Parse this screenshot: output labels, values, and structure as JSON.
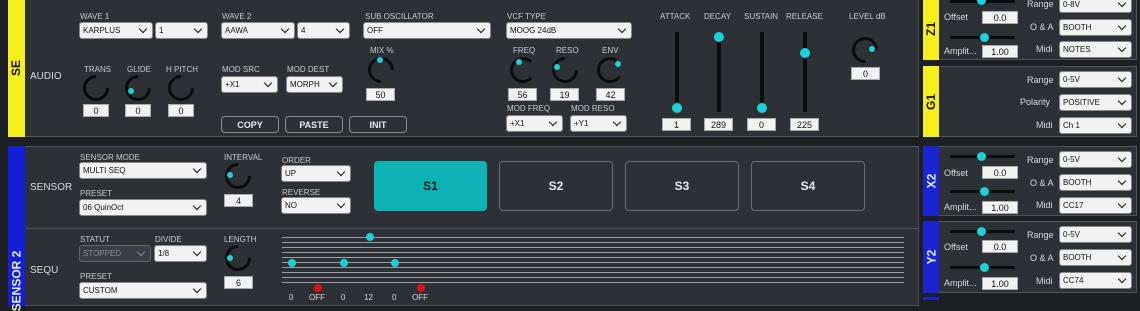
{
  "colors": {
    "accent": "#19d3d8",
    "sensor1_tab": "#f5ef1c",
    "sensor2_tab": "#1320d8",
    "z1_tab": "#f5ef1c",
    "g1_tab": "#f5ef1c",
    "x2_tab": "#1a24d0",
    "y2_tab": "#1a24d0",
    "seq_red": "#e01010"
  },
  "sensor1": {
    "tab_label": "SE",
    "audio_label": "AUDIO",
    "wave1": {
      "label": "WAVE 1",
      "value": "KARPLUS",
      "num": "1"
    },
    "wave2": {
      "label": "WAVE 2",
      "value": "AAWA",
      "num": "4"
    },
    "sub_osc": {
      "label": "SUB OSCILLATOR",
      "value": "OFF"
    },
    "vcf_type": {
      "label": "VCF TYPE",
      "value": "MOOG 24dB"
    },
    "trans": {
      "label": "TRANS",
      "value": "0"
    },
    "glide": {
      "label": "GLIDE",
      "value": "0"
    },
    "hpitch": {
      "label": "H PITCH",
      "value": "0"
    },
    "mod_src": {
      "label": "MOD SRC",
      "value": "+X1"
    },
    "mod_dest": {
      "label": "MOD DEST",
      "value": "MORPH"
    },
    "mix": {
      "label": "MIX %",
      "value": "50"
    },
    "freq": {
      "label": "FREQ",
      "value": "56"
    },
    "reso": {
      "label": "RESO",
      "value": "19"
    },
    "env": {
      "label": "ENV",
      "value": "42"
    },
    "mod_freq": {
      "label": "MOD FREQ",
      "value": "+X1"
    },
    "mod_reso": {
      "label": "MOD RESO",
      "value": "+Y1"
    },
    "copy": "COPY",
    "paste": "PASTE",
    "init": "INIT",
    "attack": {
      "label": "ATTACK",
      "value": "1",
      "level": 0.0
    },
    "decay": {
      "label": "DECAY",
      "value": "289",
      "level": 0.95
    },
    "sustain": {
      "label": "SUSTAIN",
      "value": "0",
      "level": 0.0
    },
    "release": {
      "label": "RELEASE",
      "value": "225",
      "level": 0.78
    },
    "level": {
      "label": "LEVEL dB",
      "value": "0"
    }
  },
  "sensor2": {
    "tab_label": "SENSOR 2",
    "sensor_label": "SENSOR",
    "sensor_mode": {
      "label": "SENSOR MODE",
      "value": "MULTI SEQ"
    },
    "preset": {
      "label": "PRESET",
      "value": "06 QuinOct"
    },
    "interval": {
      "label": "INTERVAL",
      "value": "4"
    },
    "order": {
      "label": "ORDER",
      "value": "UP"
    },
    "reverse": {
      "label": "REVERSE",
      "value": "NO"
    },
    "s_buttons": [
      "S1",
      "S2",
      "S3",
      "S4"
    ],
    "active_s": "S1",
    "sequ_label": "SEQU",
    "statut": {
      "label": "STATUT",
      "value": "STOPPED"
    },
    "divide": {
      "label": "DIVIDE",
      "value": "1/8"
    },
    "length": {
      "label": "LENGTH",
      "value": "6"
    },
    "seq_preset": {
      "label": "PRESET",
      "value": "CUSTOM"
    },
    "steps": [
      "0",
      "OFF",
      "0",
      "12",
      "0",
      "OFF"
    ]
  },
  "right": {
    "z1": {
      "tab": "Z1",
      "offset_label": "Offset",
      "offset_value": "0.0",
      "ampl_label": "Amplit...",
      "ampl_value": "1.00",
      "range_label": "Range",
      "range_value": "0-8V",
      "oa_label": "O & A",
      "oa_value": "BOOTH",
      "midi_label": "Midi",
      "midi_value": "NOTES"
    },
    "g1": {
      "tab": "G1",
      "range_label": "Range",
      "range_value": "0-5V",
      "pol_label": "Polarity",
      "pol_value": "POSITIVE",
      "midi_label": "Midi",
      "midi_value": "Ch 1"
    },
    "x2": {
      "tab": "X2",
      "offset_label": "Offset",
      "offset_value": "0.0",
      "ampl_label": "Amplit...",
      "ampl_value": "1.00",
      "range_label": "Range",
      "range_value": "0-5V",
      "oa_label": "O & A",
      "oa_value": "BOOTH",
      "midi_label": "Midi",
      "midi_value": "CC17"
    },
    "y2": {
      "tab": "Y2",
      "offset_label": "Offset",
      "offset_value": "0.0",
      "ampl_label": "Amplit...",
      "ampl_value": "1.00",
      "range_label": "Range",
      "range_value": "0-5V",
      "oa_label": "O & A",
      "oa_value": "BOOTH",
      "midi_label": "Midi",
      "midi_value": "CC74"
    }
  }
}
